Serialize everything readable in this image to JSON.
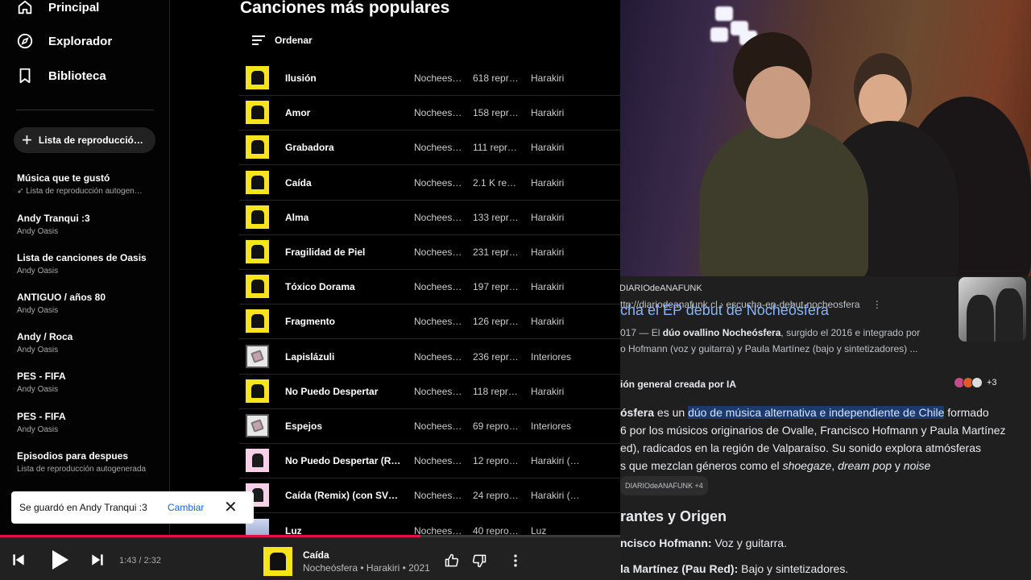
{
  "sidebar": {
    "nav": [
      {
        "label": "Principal",
        "icon": "home-icon"
      },
      {
        "label": "Explorador",
        "icon": "compass-icon"
      },
      {
        "label": "Biblioteca",
        "icon": "library-icon"
      }
    ],
    "new_playlist_label": "Lista de reproducció…",
    "playlists": [
      {
        "title": "Música que te gustó",
        "subtitle": "Lista de reproducción autogen…",
        "pinned": true
      },
      {
        "title": "Andy Tranqui :3",
        "subtitle": "Andy Oasis"
      },
      {
        "title": "Lista de canciones de Oasis",
        "subtitle": "Andy Oasis"
      },
      {
        "title": "ANTIGUO / años 80",
        "subtitle": "Andy Oasis"
      },
      {
        "title": "Andy / Roca",
        "subtitle": "Andy Oasis"
      },
      {
        "title": "PES - FIFA",
        "subtitle": "Andy Oasis"
      },
      {
        "title": "PES - FIFA",
        "subtitle": "Andy Oasis"
      },
      {
        "title": "Episodios para despues",
        "subtitle": "Lista de reproducción autogenerada"
      }
    ]
  },
  "main": {
    "title": "Canciones más populares",
    "sort_label": "Ordenar",
    "songs": [
      {
        "title": "Ilusión",
        "artist": "Nochees…",
        "plays": "618 repr…",
        "album": "Harakiri",
        "art": "yellow"
      },
      {
        "title": "Amor",
        "artist": "Nochees…",
        "plays": "158 repr…",
        "album": "Harakiri",
        "art": "yellow"
      },
      {
        "title": "Grabadora",
        "artist": "Nochees…",
        "plays": "111 repr…",
        "album": "Harakiri",
        "art": "yellow"
      },
      {
        "title": "Caída",
        "artist": "Nochees…",
        "plays": "2.1 K rep…",
        "album": "Harakiri",
        "art": "yellow"
      },
      {
        "title": "Alma",
        "artist": "Nochees…",
        "plays": "133 repr…",
        "album": "Harakiri",
        "art": "yellow"
      },
      {
        "title": "Fragilidad de Piel",
        "artist": "Nochees…",
        "plays": "231 repr…",
        "album": "Harakiri",
        "art": "yellow"
      },
      {
        "title": "Tóxico Dorama",
        "artist": "Nochees…",
        "plays": "197 repr…",
        "album": "Harakiri",
        "art": "yellow"
      },
      {
        "title": "Fragmento",
        "artist": "Nochees…",
        "plays": "126 repr…",
        "album": "Harakiri",
        "art": "yellow"
      },
      {
        "title": "Lapislázuli",
        "artist": "Nochees…",
        "plays": "236 repr…",
        "album": "Interiores",
        "art": "grey"
      },
      {
        "title": "No Puedo Despertar",
        "artist": "Nochees…",
        "plays": "118 repr…",
        "album": "Harakiri",
        "art": "yellow"
      },
      {
        "title": "Espejos",
        "artist": "Nochees…",
        "plays": "69 repro…",
        "album": "Interiores",
        "art": "grey"
      },
      {
        "title": "No Puedo Despertar (Re…",
        "artist": "Nochees…",
        "plays": "12 repro…",
        "album": "Harakiri (…",
        "art": "pink"
      },
      {
        "title": "Caída (Remix) (con SVN…",
        "artist": "Nochees…",
        "plays": "24 repro…",
        "album": "Harakiri (…",
        "art": "pink"
      },
      {
        "title": "Luz",
        "artist": "Nochees…",
        "plays": "40 repro…",
        "album": "Luz",
        "art": "sky"
      }
    ]
  },
  "toast": {
    "message": "Se guardó en Andy Tranqui :3",
    "action": "Cambiar"
  },
  "player": {
    "time": "1:43 / 2:32",
    "progress": 0.678,
    "now_title": "Caída",
    "now_subtitle": "Nocheósfera • Harakiri • 2021",
    "accent": "#e0124a"
  },
  "web": {
    "site": "DIARIOdeANAFUNK",
    "url": "ttp://diariodeanafunk.cl › escucha-ep-debut-nocheosfera",
    "title": "cha el EP debut de Nocheósfera",
    "snippet_prefix": "017 — El ",
    "snippet_bold1": "dúo ovallino Nocheósfera",
    "snippet_mid": ", surgido el 2016 e integrado por",
    "snippet_line2": "o Hofmann (voz y guitarra) y Paula Martínez (bajo y sintetizadores) ...",
    "ai_heading": "ión general creada por IA",
    "ai_count": "+3",
    "ai_l1_a": "ósfera",
    "ai_l1_b": " es un ",
    "ai_l1_hl": "dúo de música alternativa e independiente de Chile",
    "ai_l1_c": " formado",
    "ai_l2": "6 por los músicos originarios de Ovalle, Francisco Hofmann y Paula Martínez",
    "ai_l3": "ed), radicados en la región de Valparaíso. Su sonido explora atmósferas",
    "ai_l4_a": "s que mezclan géneros como el ",
    "ai_l4_i1": "shoegaze",
    "ai_l4_b": ", ",
    "ai_l4_i2": "dream pop",
    "ai_l4_c": " y ",
    "ai_l4_i3": "noise",
    "chip": "DIARIOdeANAFUNK +4",
    "section_heading": "rantes y Origen",
    "member1_name": "ncisco Hofmann:",
    "member1_role": " Voz y guitarra.",
    "member2_name": "la Martínez (Pau Red):",
    "member2_role": " Bajo y sintetizadores."
  }
}
